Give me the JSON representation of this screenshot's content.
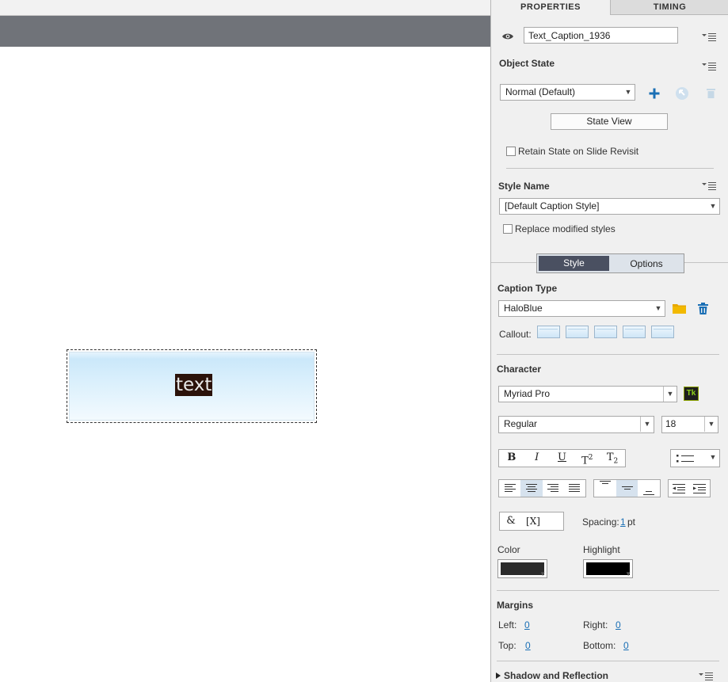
{
  "stage": {
    "caption_text": "text"
  },
  "panel": {
    "tabs": [
      {
        "label": "PROPERTIES"
      },
      {
        "label": "TIMING"
      }
    ],
    "object_name": "Text_Caption_1936",
    "object_state": {
      "heading": "Object State",
      "selected": "Normal (Default)",
      "state_view_label": "State View",
      "retain_label": "Retain State on Slide Revisit"
    },
    "style_name": {
      "heading": "Style Name",
      "selected": "[Default Caption Style]",
      "replace_label": "Replace modified styles"
    },
    "subtabs": [
      {
        "label": "Style"
      },
      {
        "label": "Options"
      }
    ],
    "caption_type": {
      "heading": "Caption Type",
      "selected": "HaloBlue",
      "callout_label": "Callout:"
    },
    "character": {
      "heading": "Character",
      "font": "Myriad Pro",
      "typekit_label": "Tk",
      "style": "Regular",
      "size": "18",
      "format_buttons": [
        "B",
        "I",
        "U",
        "T",
        "T"
      ],
      "superscript": "2",
      "subscript": "2",
      "spacing_label": "Spacing:",
      "spacing_value": "1",
      "spacing_unit": "pt",
      "color_label": "Color",
      "highlight_label": "Highlight",
      "symbol_button": "&",
      "variable_button": "[X]"
    },
    "margins": {
      "heading": "Margins",
      "left_label": "Left:",
      "left_value": "0",
      "right_label": "Right:",
      "right_value": "0",
      "top_label": "Top:",
      "top_value": "0",
      "bottom_label": "Bottom:",
      "bottom_value": "0"
    },
    "shadow": {
      "heading": "Shadow and Reflection"
    }
  },
  "colors": {
    "text_color": "#2b2b2b",
    "highlight_color": "#000000",
    "accent_blue": "#1a6fb5",
    "folder_yellow": "#e8a800",
    "active_subtab": "#4a5061"
  }
}
